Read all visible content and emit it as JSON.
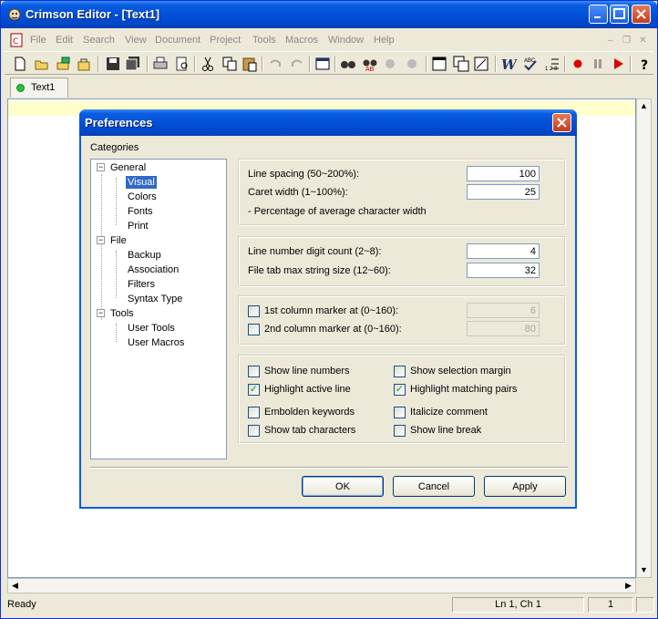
{
  "window": {
    "title": "Crimson Editor - [Text1]"
  },
  "menu": [
    "File",
    "Edit",
    "Search",
    "View",
    "Document",
    "Project",
    "Tools",
    "Macros",
    "Window",
    "Help"
  ],
  "tabs": [
    {
      "label": "Text1"
    }
  ],
  "status": {
    "text": "Ready",
    "position": "Ln 1, Ch 1",
    "extra": "1"
  },
  "dialog": {
    "title": "Preferences",
    "categories_label": "Categories",
    "tree": [
      {
        "label": "General",
        "children": [
          "Visual",
          "Colors",
          "Fonts",
          "Print"
        ]
      },
      {
        "label": "File",
        "children": [
          "Backup",
          "Association",
          "Filters",
          "Syntax Type"
        ]
      },
      {
        "label": "Tools",
        "children": [
          "User Tools",
          "User Macros"
        ]
      }
    ],
    "selected_category": "Visual",
    "spacing": {
      "line_spacing_label": "Line spacing (50~200%):",
      "line_spacing_value": "100",
      "caret_width_label": "Caret width (1~100%):",
      "caret_width_value": "25",
      "note": "- Percentage of average character width"
    },
    "numbers": {
      "digit_count_label": "Line number digit count (2~8):",
      "digit_count_value": "4",
      "tab_max_label": "File tab max string size (12~60):",
      "tab_max_value": "32"
    },
    "markers": {
      "first_label": "1st column marker at (0~160):",
      "first_value": "6",
      "first_checked": false,
      "second_label": "2nd column marker at (0~160):",
      "second_value": "80",
      "second_checked": false
    },
    "options": [
      {
        "label": "Show line numbers",
        "checked": false
      },
      {
        "label": "Show selection margin",
        "checked": false
      },
      {
        "label": "Highlight active line",
        "checked": true
      },
      {
        "label": "Highlight matching pairs",
        "checked": true
      },
      {
        "label": "Embolden keywords",
        "checked": false
      },
      {
        "label": "Italicize comment",
        "checked": false
      },
      {
        "label": "Show tab characters",
        "checked": false
      },
      {
        "label": "Show line break",
        "checked": false
      }
    ],
    "buttons": {
      "ok": "OK",
      "cancel": "Cancel",
      "apply": "Apply"
    }
  }
}
